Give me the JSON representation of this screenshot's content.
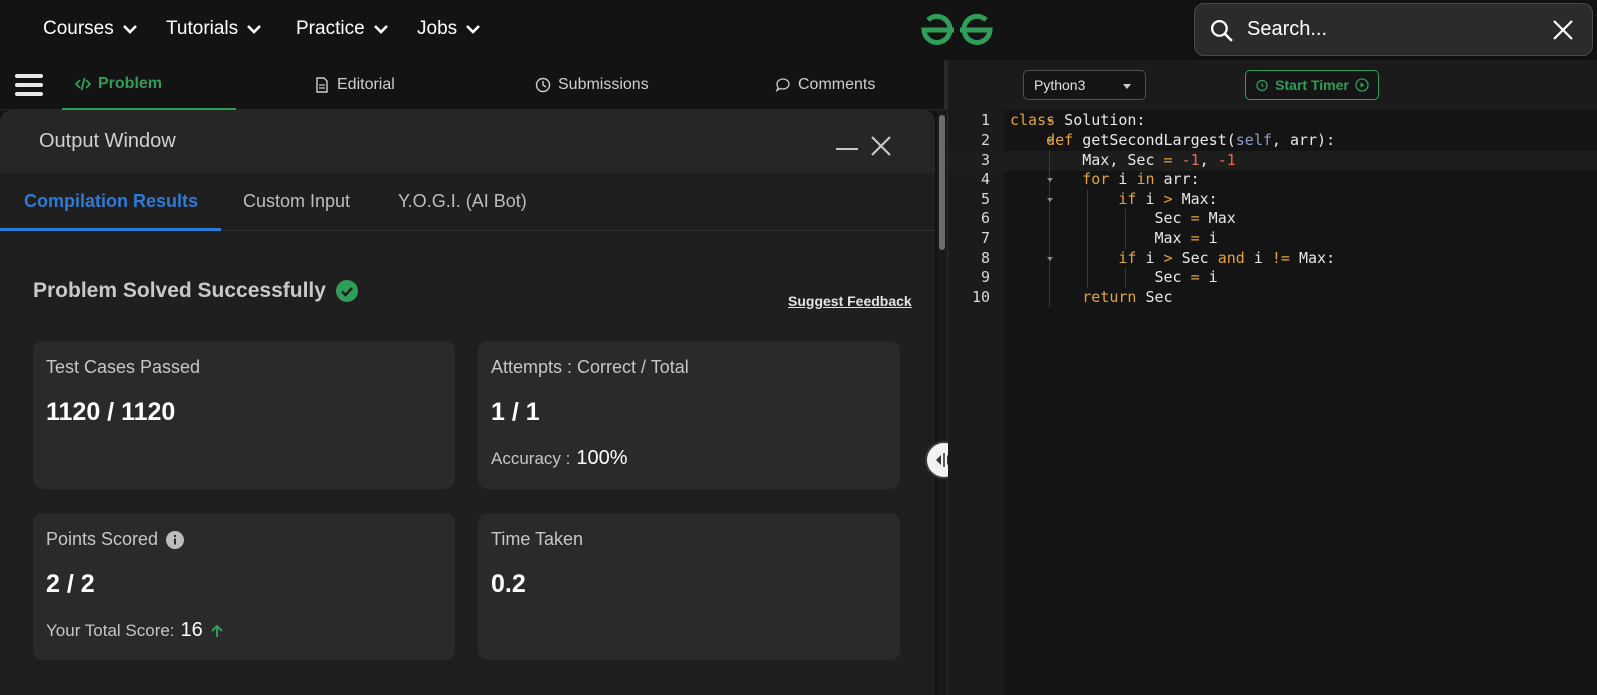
{
  "navbar": {
    "items": [
      {
        "label": "Courses"
      },
      {
        "label": "Tutorials"
      },
      {
        "label": "Practice"
      },
      {
        "label": "Jobs"
      }
    ],
    "search_placeholder": "Search..."
  },
  "problem_tabs": [
    {
      "label": "Problem",
      "active": true
    },
    {
      "label": "Editorial"
    },
    {
      "label": "Submissions"
    },
    {
      "label": "Comments"
    }
  ],
  "output_window": {
    "title": "Output Window",
    "tabs": [
      {
        "label": "Compilation Results",
        "active": true
      },
      {
        "label": "Custom Input"
      },
      {
        "label": "Y.O.G.I. (AI Bot)"
      }
    ],
    "status": "Problem Solved Successfully",
    "suggest_feedback": "Suggest Feedback",
    "cards": {
      "test_cases": {
        "label": "Test Cases Passed",
        "value": "1120 / 1120"
      },
      "attempts": {
        "label": "Attempts : Correct / Total",
        "value": "1 / 1",
        "sub_label": "Accuracy :",
        "sub_value": "100%"
      },
      "points": {
        "label": "Points Scored",
        "value": "2 / 2",
        "sub_label": "Your Total Score:",
        "sub_value": "16"
      },
      "time": {
        "label": "Time Taken",
        "value": "0.2"
      }
    }
  },
  "editor": {
    "language": "Python3",
    "timer_label": "Start Timer",
    "line_numbers": [
      "1",
      "2",
      "3",
      "4",
      "5",
      "6",
      "7",
      "8",
      "9",
      "10"
    ],
    "lines": [
      "class Solution:",
      "    def getSecondLargest(self, arr):",
      "        Max, Sec = -1, -1",
      "        for i in arr:",
      "            if i > Max:",
      "                Sec = Max",
      "                Max = i",
      "            if i > Sec and i != Max:",
      "                Sec = i",
      "        return Sec"
    ]
  },
  "colors": {
    "accent_green": "#2f9e58",
    "accent_blue": "#2e7ad8",
    "keyword": "#e3a33b",
    "number": "#e56b4b"
  },
  "icons": [
    "chevron-down-icon",
    "search-icon",
    "close-icon",
    "code-icon",
    "document-icon",
    "clock-icon",
    "chat-icon",
    "check-circle-icon",
    "info-icon",
    "arrow-up-icon",
    "alarm-icon",
    "play-circle-icon",
    "splitter-icon"
  ]
}
